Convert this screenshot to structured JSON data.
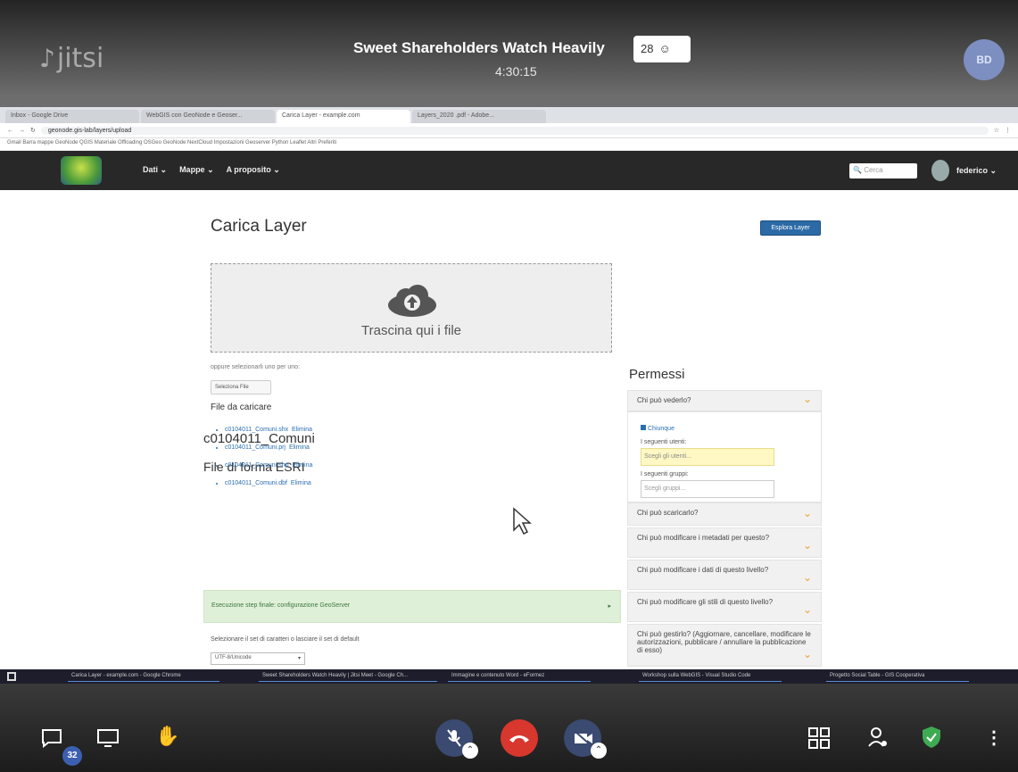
{
  "jitsi": {
    "logo": "jitsi",
    "meeting_title": "Sweet Shareholders Watch Heavily",
    "participant_count": "28",
    "timer": "4:30:15",
    "avatar_initials": "BD",
    "chat_unread": "32"
  },
  "browser": {
    "tabs": [
      "Inbox - Google Drive",
      "WebGIS con GeoNode e Geoser...",
      "Carica Layer - example.com",
      "Layers_2020 .pdf - Adobe..."
    ],
    "url": "geonode.gis-lab/layers/upload",
    "bookmarks": "Gmail   Barra mappe   GeoNode   QGIS   Materiale   Offloading   OSGeo   GeoNode   NextCloud   Impostazioni   Geoserver   Python   Leaflet   Altri Preferiti"
  },
  "navbar": {
    "menu": [
      "Dati",
      "Mappe",
      "A proposito"
    ],
    "search_placeholder": "Cerca",
    "user": "federico"
  },
  "upload": {
    "title": "Carica Layer",
    "explore_button": "Esplora Layer",
    "drop_text": "Trascina qui i file",
    "or_text": "oppure selezionarli uno per uno:",
    "select_button": "Seleziona File",
    "files_heading": "File da caricare",
    "layer_name": "c0104011_Comuni",
    "shapefile_heading": "File di forma ESRI",
    "files": [
      {
        "name": "c0104011_Comuni.shx",
        "remove": "Elimina"
      },
      {
        "name": "c0104011_Comuni.prj",
        "remove": "Elimina"
      },
      {
        "name": "c0104011_Comuni.shp",
        "remove": "Elimina"
      },
      {
        "name": "c0104011_Comuni.dbf",
        "remove": "Elimina"
      }
    ],
    "success_text": "Esecuzione step finale: configurazione GeoServer",
    "charset_label": "Selezionare il set di caratteri o lasciare il set di default",
    "charset_value": "UTF-8/Unicode"
  },
  "permissions": {
    "title": "Permessi",
    "view_heading": "Chi può vederlo?",
    "anyone_label": "Chiunque",
    "users_label": "I seguenti utenti:",
    "users_placeholder": "Scegli gli utenti...",
    "groups_label": "I seguenti gruppi:",
    "groups_placeholder": "Scegli gruppi...",
    "download_heading": "Chi può scaricarlo?",
    "metadata_heading": "Chi può modificare i metadati per questo?",
    "data_heading": "Chi può modificare i dati di questo livello?",
    "styles_heading": "Chi può modificare gli stili di questo livello?",
    "manage_heading": "Chi può gestirlo? (Aggiornare, cancellare, modificare le autorizzazioni, pubblicare / annullare la pubblicazione di esso)"
  },
  "taskbar": {
    "tasks": [
      "Carica Layer - example.com - Google Chrome",
      "Sweet Shareholders Watch Heavily | Jitsi Meet - Google Ch...",
      "Immagine e contenuto Word - eFormez",
      "Workshop sulla WebGIS - Visual Studio Code",
      "Progetto Social Table - GIS Cooperativa"
    ]
  },
  "colors": {
    "accent": "#2c6aa6",
    "hangup": "#d8372e",
    "chevron": "#f0a030"
  }
}
